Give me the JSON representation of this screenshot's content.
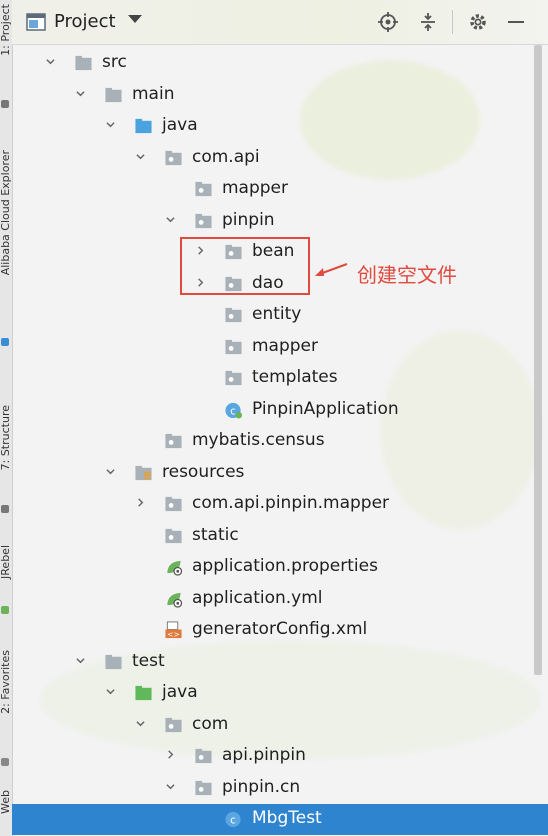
{
  "window": {
    "title": "Project"
  },
  "side_tabs": [
    "1: Project",
    "Alibaba Cloud Explorer",
    "7: Structure",
    "JRebel",
    "2: Favorites",
    "Web"
  ],
  "tree": [
    {
      "label": "src",
      "depth": 0,
      "expanded": true,
      "icon": "folder-icon"
    },
    {
      "label": "main",
      "depth": 1,
      "expanded": true,
      "icon": "folder-icon"
    },
    {
      "label": "java",
      "depth": 2,
      "expanded": true,
      "icon": "source-folder-icon"
    },
    {
      "label": "com.api",
      "depth": 3,
      "expanded": true,
      "icon": "package-icon"
    },
    {
      "label": "mapper",
      "depth": 4,
      "expanded": null,
      "icon": "package-icon"
    },
    {
      "label": "pinpin",
      "depth": 4,
      "expanded": true,
      "icon": "package-icon"
    },
    {
      "label": "bean",
      "depth": 5,
      "expanded": false,
      "icon": "package-icon"
    },
    {
      "label": "dao",
      "depth": 5,
      "expanded": false,
      "icon": "package-icon"
    },
    {
      "label": "entity",
      "depth": 5,
      "expanded": null,
      "icon": "package-icon"
    },
    {
      "label": "mapper",
      "depth": 5,
      "expanded": null,
      "icon": "package-icon"
    },
    {
      "label": "templates",
      "depth": 5,
      "expanded": null,
      "icon": "package-icon"
    },
    {
      "label": "PinpinApplication",
      "depth": 5,
      "expanded": null,
      "icon": "spring-app-class-icon"
    },
    {
      "label": "mybatis.census",
      "depth": 3,
      "expanded": null,
      "icon": "package-icon"
    },
    {
      "label": "resources",
      "depth": 2,
      "expanded": true,
      "icon": "resources-folder-icon"
    },
    {
      "label": "com.api.pinpin.mapper",
      "depth": 3,
      "expanded": false,
      "icon": "package-icon"
    },
    {
      "label": "static",
      "depth": 3,
      "expanded": null,
      "icon": "package-icon"
    },
    {
      "label": "application.properties",
      "depth": 3,
      "expanded": null,
      "icon": "spring-config-icon"
    },
    {
      "label": "application.yml",
      "depth": 3,
      "expanded": null,
      "icon": "spring-config-icon"
    },
    {
      "label": "generatorConfig.xml",
      "depth": 3,
      "expanded": null,
      "icon": "xml-file-icon"
    },
    {
      "label": "test",
      "depth": 1,
      "expanded": true,
      "icon": "folder-icon"
    },
    {
      "label": "java",
      "depth": 2,
      "expanded": true,
      "icon": "test-source-folder-icon"
    },
    {
      "label": "com",
      "depth": 3,
      "expanded": true,
      "icon": "package-icon"
    },
    {
      "label": "api.pinpin",
      "depth": 4,
      "expanded": false,
      "icon": "package-icon"
    },
    {
      "label": "pinpin.cn",
      "depth": 4,
      "expanded": true,
      "icon": "package-icon"
    },
    {
      "label": "MbgTest",
      "depth": 5,
      "expanded": null,
      "icon": "class-icon",
      "selected": true
    }
  ],
  "annotation": {
    "text": "创建空文件"
  },
  "colors": {
    "selection": "#2f84cf",
    "annotation": "#e04a3f",
    "folder": "#a9b1b8",
    "source_folder": "#4aa3df",
    "test_folder": "#5fb85a"
  }
}
